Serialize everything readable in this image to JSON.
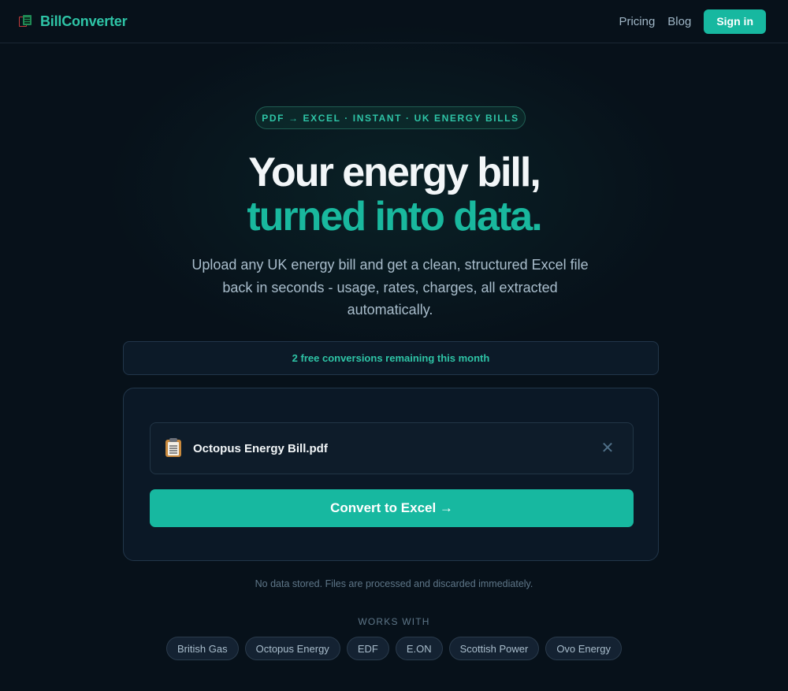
{
  "nav": {
    "brand": "BillConverter",
    "links": [
      "Pricing",
      "Blog"
    ],
    "signin": "Sign in"
  },
  "hero": {
    "pill": "PDF → EXCEL · INSTANT · UK ENERGY BILLS",
    "title_line1": "Your energy bill,",
    "title_line2": "turned into data.",
    "subtitle": "Upload any UK energy bill and get a clean, structured Excel file back in seconds - usage, rates, charges, all extracted automatically."
  },
  "quota": "2 free conversions remaining this month",
  "upload": {
    "file_name": "Octopus Energy Bill.pdf",
    "file_icon": "clipboard-icon",
    "remove_icon": "close-icon",
    "convert_label": "Convert to Excel →"
  },
  "privacy_note": "No data stored. Files are processed and discarded immediately.",
  "works_with": {
    "label": "WORKS WITH",
    "providers": [
      "British Gas",
      "Octopus Energy",
      "EDF",
      "E.ON",
      "Scottish Power",
      "Ovo Energy"
    ]
  },
  "colors": {
    "accent": "#17b8a0",
    "background": "#07111a"
  }
}
